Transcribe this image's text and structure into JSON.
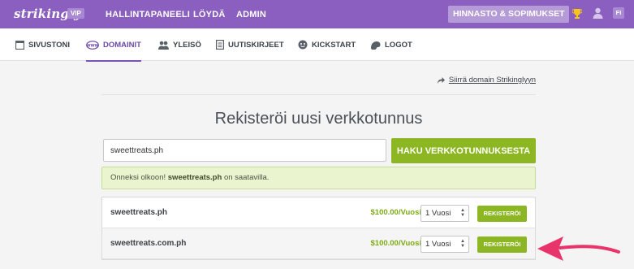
{
  "topbar": {
    "logo": "strikingly",
    "vip_badge": "VIP",
    "nav": [
      "HALLINTAPANEELI",
      "LÖYDÄ",
      "ADMIN"
    ],
    "pricing_button": "HINNASTO & SOPIMUKSET",
    "language_badge": "FI",
    "icons": [
      "trophy-icon",
      "user-icon"
    ]
  },
  "subnav": {
    "items": [
      {
        "label": "SIVUSTONI",
        "icon": "site-icon"
      },
      {
        "label": "DOMAINIT",
        "icon": "www-icon",
        "active": true
      },
      {
        "label": "YLEISÖ",
        "icon": "audience-icon"
      },
      {
        "label": "UUTISKIRJEET",
        "icon": "newsletter-icon"
      },
      {
        "label": "KICKSTART",
        "icon": "kickstart-icon"
      },
      {
        "label": "LOGOT",
        "icon": "logo-icon"
      }
    ]
  },
  "main": {
    "move_link": "Siirrä domain Strikinglyyn",
    "title": "Rekisteröi uusi verkkotunnus",
    "search": {
      "value": "sweettreats.ph",
      "button": "HAKU VERKKOTUNNUKSESTA"
    },
    "notice": {
      "prefix": "Onneksi olkoon!",
      "domain": "sweettreats.ph",
      "suffix": "on saatavilla."
    },
    "results": [
      {
        "domain": "sweettreats.ph",
        "price": "$100.00/Vuosi",
        "term": "1 Vuosi",
        "button": "REKISTERÖI"
      },
      {
        "domain": "sweettreats.com.ph",
        "price": "$100.00/Vuosi",
        "term": "1 Vuosi",
        "button": "REKISTERÖI"
      }
    ]
  },
  "colors": {
    "brand_purple": "#8a5fc0",
    "accent_green": "#8cb722",
    "price_green": "#7cab16",
    "arrow_pink": "#e9336b"
  }
}
